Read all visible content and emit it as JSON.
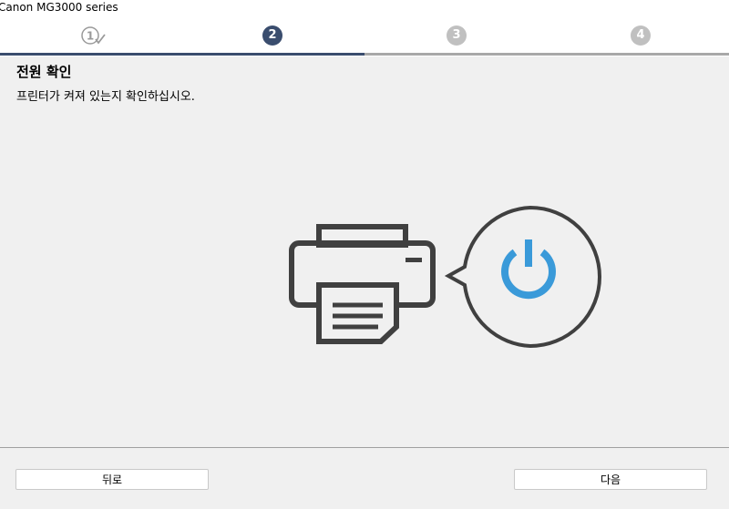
{
  "window": {
    "title": "Canon MG3000 series"
  },
  "steps": [
    {
      "label": "1",
      "state": "done"
    },
    {
      "label": "2",
      "state": "current"
    },
    {
      "label": "3",
      "state": "pending"
    },
    {
      "label": "4",
      "state": "pending"
    }
  ],
  "page": {
    "heading": "전원 확인",
    "instruction": "프린터가 켜져 있는지 확인하십시오."
  },
  "illustration": {
    "printer_icon": "printer-icon",
    "power_icon": "power-icon",
    "power_color": "#3a9ad9",
    "outline_color": "#404040"
  },
  "footer": {
    "back_label": "뒤로",
    "next_label": "다음"
  },
  "colors": {
    "active_step": "#3a4d6e",
    "inactive_step": "#c0c0c0"
  }
}
